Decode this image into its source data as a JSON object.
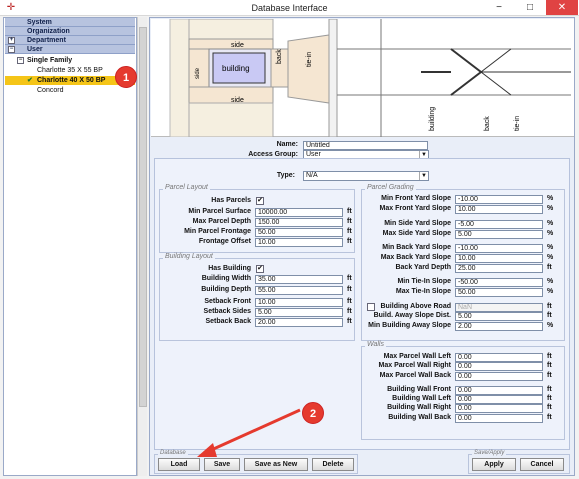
{
  "window": {
    "title": "Database Interface",
    "icon": "app-icon",
    "minimize": "−",
    "maximize": "□",
    "close": "✕"
  },
  "tree": {
    "headers": [
      "System",
      "Organization",
      "Department",
      "User"
    ],
    "items": [
      "Single Family",
      "Charlotte 35 X 55 BP",
      "Charlotte 40 X 50 BP",
      "Concord"
    ],
    "selected": "Charlotte 40 X 50 BP"
  },
  "diagram": {
    "labels": {
      "side_top": "side",
      "side_bottom": "side",
      "building": "building",
      "back": "back",
      "tie_in": "tie-in",
      "building_vertical": "building",
      "back_vertical": "back",
      "tie_in_vertical": "tie-in",
      "side_left": "side"
    }
  },
  "header_fields": {
    "name_label": "Name:",
    "name_value": "Untitled",
    "access_label": "Access Group:",
    "access_value": "User",
    "type_label": "Type:",
    "type_value": "N/A"
  },
  "parcel_layout": {
    "title": "Parcel Layout",
    "rows": [
      {
        "label": "Has Parcels",
        "checked": "✔"
      },
      {
        "label": "Min Parcel Surface",
        "value": "10000.00",
        "unit": "ft"
      },
      {
        "label": "Max Parcel Depth",
        "value": "150.00",
        "unit": "ft"
      },
      {
        "label": "Min Parcel Frontage",
        "value": "50.00",
        "unit": "ft"
      },
      {
        "label": "Frontage Offset",
        "value": "10.00",
        "unit": "ft"
      }
    ]
  },
  "building_layout": {
    "title": "Building Layout",
    "rows": [
      {
        "label": "Has Building",
        "checked": "✔"
      },
      {
        "label": "Building Width",
        "value": "35.00",
        "unit": "ft"
      },
      {
        "label": "Building Depth",
        "value": "55.00",
        "unit": "ft"
      },
      {
        "label": "Setback Front",
        "value": "10.00",
        "unit": "ft"
      },
      {
        "label": "Setback Sides",
        "value": "5.00",
        "unit": "ft"
      },
      {
        "label": "Setback Back",
        "value": "20.00",
        "unit": "ft"
      }
    ]
  },
  "parcel_grading": {
    "title": "Parcel Grading",
    "rows": [
      {
        "label": "Min Front Yard Slope",
        "value": "-10.00",
        "unit": "%"
      },
      {
        "label": "Max Front Yard Slope",
        "value": "10.00",
        "unit": "%"
      },
      {
        "label": "Min Side Yard Slope",
        "value": "-5.00",
        "unit": "%"
      },
      {
        "label": "Max Side Yard Slope",
        "value": "5.00",
        "unit": "%"
      },
      {
        "label": "Min Back Yard Slope",
        "value": "-10.00",
        "unit": "%"
      },
      {
        "label": "Max Back Yard Slope",
        "value": "10.00",
        "unit": "%"
      },
      {
        "label": "Back Yard Depth",
        "value": "25.00",
        "unit": "ft"
      },
      {
        "label": "Min Tie-In Slope",
        "value": "-50.00",
        "unit": "%"
      },
      {
        "label": "Max Tie-In Slope",
        "value": "50.00",
        "unit": "%"
      },
      {
        "label": "Building Above Road",
        "value": "NaN",
        "unit": "ft"
      },
      {
        "label": "Build. Away Slope Dist.",
        "value": "5.00",
        "unit": "ft"
      },
      {
        "label": "Min Building Away Slope",
        "value": "2.00",
        "unit": "%"
      }
    ]
  },
  "walls": {
    "title": "Walls",
    "rows": [
      {
        "label": "Max Parcel Wall Left",
        "value": "0.00",
        "unit": "ft"
      },
      {
        "label": "Max Parcel Wall Right",
        "value": "0.00",
        "unit": "ft"
      },
      {
        "label": "Max Parcel Wall Back",
        "value": "0.00",
        "unit": "ft"
      },
      {
        "label": "Building Wall Front",
        "value": "0.00",
        "unit": "ft"
      },
      {
        "label": "Building Wall Left",
        "value": "0.00",
        "unit": "ft"
      },
      {
        "label": "Building Wall Right",
        "value": "0.00",
        "unit": "ft"
      },
      {
        "label": "Building Wall Back",
        "value": "0.00",
        "unit": "ft"
      }
    ]
  },
  "database_group": {
    "title": "Database",
    "buttons": [
      "Load",
      "Save",
      "Save as New",
      "Delete"
    ]
  },
  "save_apply_group": {
    "title": "Save/Apply",
    "buttons": [
      "Apply",
      "Cancel"
    ]
  },
  "annotations": {
    "badge1": "1",
    "badge2": "2",
    "arrow_color": "#e53a2e"
  }
}
